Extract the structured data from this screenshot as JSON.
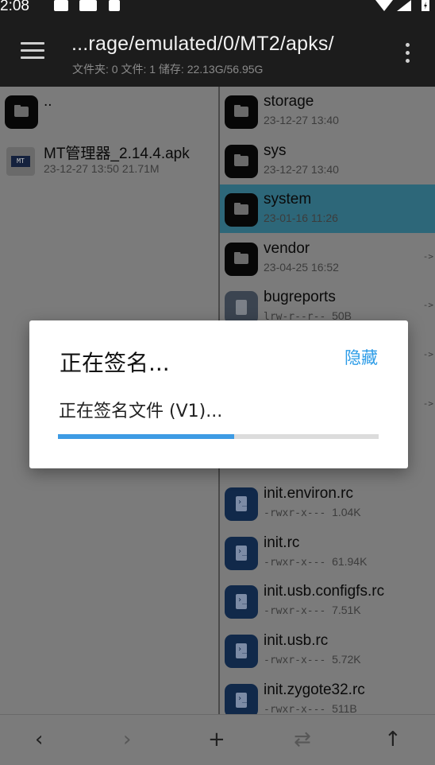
{
  "status_bar": {
    "time": "2:08",
    "icons_left": [
      "image-icon",
      "mt-app-icon",
      "a-text-icon"
    ],
    "icons_right": [
      "wifi-icon",
      "signal-icon",
      "battery-icon"
    ]
  },
  "app_bar": {
    "path": "...rage/emulated/0/MT2/apks/",
    "summary": "文件夹: 0  文件: 1  储存: 22.13G/56.95G"
  },
  "left_pane": {
    "items": [
      {
        "name": "..",
        "meta": "",
        "icon": "folder-icon"
      },
      {
        "name": "MT管理器_2.14.4.apk",
        "meta": "23-12-27 13:50  21.71M",
        "icon": "apk-icon"
      }
    ]
  },
  "right_pane": {
    "items": [
      {
        "name": "storage",
        "meta": "23-12-27 13:40",
        "perm": "",
        "icon": "folder-icon",
        "selected": false,
        "arrow": ""
      },
      {
        "name": "sys",
        "meta": "23-12-27 13:40",
        "perm": "",
        "icon": "folder-icon",
        "selected": false,
        "arrow": ""
      },
      {
        "name": "system",
        "meta": "23-01-16 11:26",
        "perm": "",
        "icon": "folder-icon",
        "selected": true,
        "arrow": ""
      },
      {
        "name": "vendor",
        "meta": "23-04-25 16:52",
        "perm": "",
        "icon": "folder-icon",
        "selected": false,
        "arrow": "->"
      },
      {
        "name": "bugreports",
        "meta": "50B",
        "perm": "lrw-r--r--",
        "icon": "file-icon",
        "selected": false,
        "arrow": "->"
      },
      {
        "name": "",
        "meta": "",
        "perm": "",
        "icon": "",
        "selected": false,
        "arrow": "->"
      },
      {
        "name": "",
        "meta": "",
        "perm": "",
        "icon": "",
        "selected": false,
        "arrow": "->"
      },
      {
        "name": "",
        "meta": "",
        "perm": "",
        "icon": "",
        "selected": false,
        "arrow": ""
      },
      {
        "name": "init.environ.rc",
        "meta": "1.04K",
        "perm": "-rwxr-x---",
        "icon": "script-icon",
        "selected": false,
        "arrow": ""
      },
      {
        "name": "init.rc",
        "meta": "61.94K",
        "perm": "-rwxr-x---",
        "icon": "script-icon",
        "selected": false,
        "arrow": ""
      },
      {
        "name": "init.usb.configfs.rc",
        "meta": "7.51K",
        "perm": "-rwxr-x---",
        "icon": "script-icon",
        "selected": false,
        "arrow": ""
      },
      {
        "name": "init.usb.rc",
        "meta": "5.72K",
        "perm": "-rwxr-x---",
        "icon": "script-icon",
        "selected": false,
        "arrow": ""
      },
      {
        "name": "init.zygote32.rc",
        "meta": "511B",
        "perm": "-rwxr-x---",
        "icon": "script-icon",
        "selected": false,
        "arrow": ""
      }
    ]
  },
  "dialog": {
    "title": "正在签名...",
    "hide_label": "隐藏",
    "message": "正在签名文件 (V1)...",
    "progress": 0.55
  },
  "bottom_bar": {
    "back": "‹",
    "forward": "›",
    "add": "+",
    "swap": "⇄",
    "up": "↑"
  },
  "colors": {
    "accent": "#2c9ce7",
    "progress": "#3d9be4",
    "selected_row": "#2d6779"
  }
}
